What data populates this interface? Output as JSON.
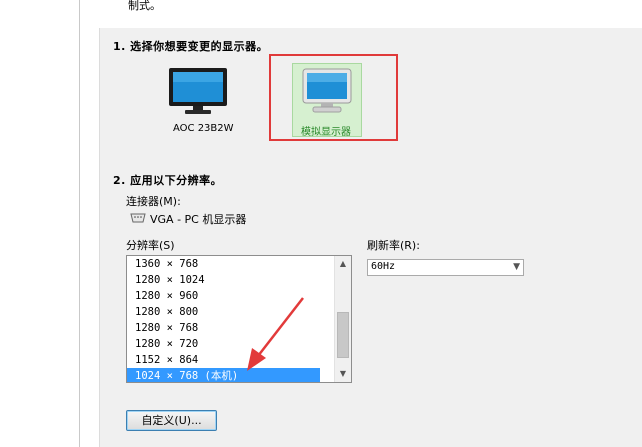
{
  "top_fragment": "制式。",
  "step1": {
    "heading": "1. 选择你想要变更的显示器。"
  },
  "monitors": [
    {
      "label": "AOC 23B2W",
      "selected": false
    },
    {
      "label": "模拟显示器",
      "selected": true
    }
  ],
  "step2": {
    "heading": "2. 应用以下分辨率。",
    "connector_label": "连接器(M):",
    "connector_value": "VGA - PC 机显示器",
    "resolution_label": "分辨率(S)",
    "refresh_label": "刷新率(R):",
    "refresh_value": "60Hz",
    "resolutions": [
      "1360 × 768",
      "1280 × 1024",
      "1280 × 960",
      "1280 × 800",
      "1280 × 768",
      "1280 × 720",
      "1152 × 864",
      "1024 × 768 (本机)"
    ],
    "selected_resolution": "1024 × 768 (本机)",
    "customize_button": "自定义(U)..."
  },
  "colors": {
    "selection": "#3399ff",
    "highlight_box": "#e03a3a",
    "selected_monitor_bg": "#d6f0d0"
  },
  "icons": [
    "monitor-icon",
    "vga-connector-icon",
    "scroll-up-icon",
    "scroll-down-icon",
    "dropdown-arrow-icon"
  ]
}
